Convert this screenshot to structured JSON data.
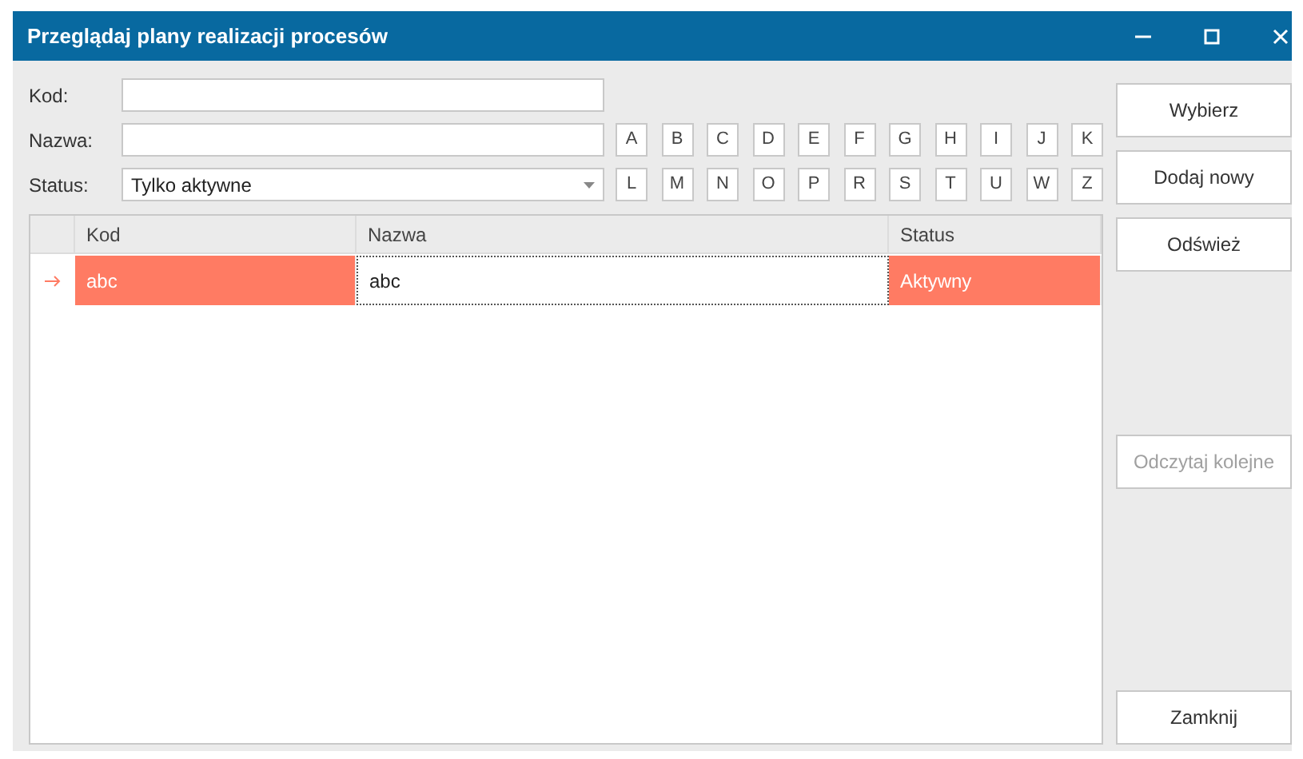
{
  "window": {
    "title": "Przeglądaj plany realizacji procesów"
  },
  "filters": {
    "kod": {
      "label": "Kod:"
    },
    "nazwa": {
      "label": "Nazwa:"
    },
    "status": {
      "label": "Status:",
      "value": "Tylko aktywne"
    }
  },
  "letters": [
    [
      "A",
      "B",
      "C",
      "D",
      "E",
      "F",
      "G",
      "H",
      "I",
      "J",
      "K"
    ],
    [
      "L",
      "M",
      "N",
      "O",
      "P",
      "R",
      "S",
      "T",
      "U",
      "W",
      "Z"
    ]
  ],
  "table": {
    "columns": [
      "Kod",
      "Nazwa",
      "Status"
    ],
    "rows": [
      {
        "selected": true,
        "cells": [
          {
            "text": "abc",
            "focused": false
          },
          {
            "text": "abc",
            "focused": true
          },
          {
            "text": "Aktywny",
            "focused": false
          }
        ]
      }
    ]
  },
  "buttons": [
    {
      "label": "Wybierz",
      "disabled": false
    },
    {
      "label": "Dodaj nowy",
      "disabled": false
    },
    {
      "label": "Odśwież",
      "disabled": false
    },
    {
      "label": "Odczytaj kolejne",
      "disabled": true
    },
    {
      "label": "Zamknij",
      "disabled": false
    }
  ]
}
